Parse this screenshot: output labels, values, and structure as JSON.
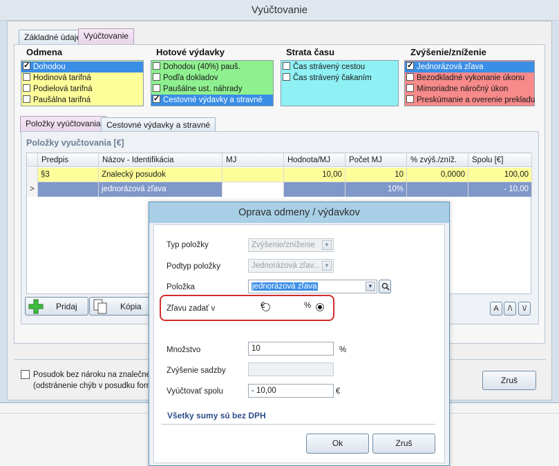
{
  "window": {
    "title": "Vyúčtovanie"
  },
  "tabs": [
    {
      "label": "Základné údaje"
    },
    {
      "label": "Vyúčtovanie"
    }
  ],
  "groups": {
    "odmena": {
      "title": "Odmena",
      "items": [
        {
          "label": "Dohodou",
          "checked": true,
          "selected": true
        },
        {
          "label": "Hodinová tarifná",
          "checked": false
        },
        {
          "label": "Podielová tarifná",
          "checked": false
        },
        {
          "label": "Paušálna tarifná",
          "checked": false
        }
      ]
    },
    "hotove": {
      "title": "Hotové výdavky",
      "items": [
        {
          "label": "Dohodou (40%) pauš.",
          "checked": false
        },
        {
          "label": "Podľa dokladov",
          "checked": false
        },
        {
          "label": "Paušálne ust. náhrady",
          "checked": false
        },
        {
          "label": "Cestovné výdavky a stravné",
          "checked": true,
          "selected": true
        }
      ]
    },
    "strata": {
      "title": "Strata času",
      "items": [
        {
          "label": "Čas strávený cestou",
          "checked": false
        },
        {
          "label": "Čas strávený čakaním",
          "checked": false
        }
      ]
    },
    "zvysenie": {
      "title": "Zvýšenie/zníženie",
      "items": [
        {
          "label": "Jednorázová zľava",
          "checked": true,
          "selected": true
        },
        {
          "label": "Bezodkladné vykonanie úkonu",
          "checked": false
        },
        {
          "label": "Mimoriadne náročný úkon",
          "checked": false
        },
        {
          "label": "Preskúmanie a overenie prekladu",
          "checked": false
        }
      ]
    }
  },
  "subtabs": [
    {
      "label": "Položky vyúčtovania"
    },
    {
      "label": "Cestovné výdavky a stravné"
    }
  ],
  "grid": {
    "title": "Položky vyučtovania   [€]",
    "columns": [
      "Predpis",
      "Názov - Identifikácia",
      "MJ",
      "Hodnota/MJ",
      "Počet MJ",
      "% zvýš./zníž.",
      "Spolu [€]"
    ],
    "rows": [
      {
        "marker": "",
        "predpis": "§3",
        "nazov": "Znalecký posudok",
        "mj": "",
        "hodnota": "10,00",
        "pocet": "10",
        "percent": "0,0000",
        "spolu": "100,00"
      },
      {
        "marker": ">",
        "predpis": "",
        "nazov": "jednorázová zľava",
        "mj": "",
        "hodnota": "",
        "pocet": "10%",
        "percent": "",
        "spolu": "- 10,00"
      }
    ]
  },
  "toolbar": {
    "add_label": "Pridaj",
    "copy_label": "Kópia",
    "nav_first": "A",
    "nav_up": "/\\",
    "nav_down": "\\/"
  },
  "footer": {
    "checkbox_line1": "Posudok bez nároku na znalečné",
    "checkbox_line2": "(odstránenie chýb v posudku formo",
    "cancel_label": "Zruš"
  },
  "dialog": {
    "title": "Oprava odmeny / výdavkov",
    "typ_label": "Typ položky",
    "typ_value": "Zvýšenie/zníženie",
    "podtyp_label": "Podtyp položky",
    "podtyp_value": "Jednorázová zľav...",
    "polozka_label": "Položka",
    "polozka_value": "jednorázová zľava",
    "zlava_label": "Zľavu zadať v",
    "radio_eur": "€",
    "radio_pct": "%",
    "radio_selected": "%",
    "mnozstvo_label": "Množstvo",
    "mnozstvo_value": "10",
    "mnozstvo_unit": "%",
    "zvysenie_label": "Zvýšenie sadzby",
    "zvysenie_value": "",
    "spolu_label": "Vyúčtovať spolu",
    "spolu_value": "-  10,00",
    "spolu_unit": "€",
    "note": "Všetky sumy sú bez DPH",
    "ok_label": "Ok",
    "cancel_label": "Zruš"
  },
  "colors": {
    "yellow": "#fdfd9a",
    "green": "#8ff08f",
    "cyan": "#8ff1f4",
    "red": "#f78a8a",
    "selected": "#3a8ee6",
    "ring": "#d52a2a"
  }
}
